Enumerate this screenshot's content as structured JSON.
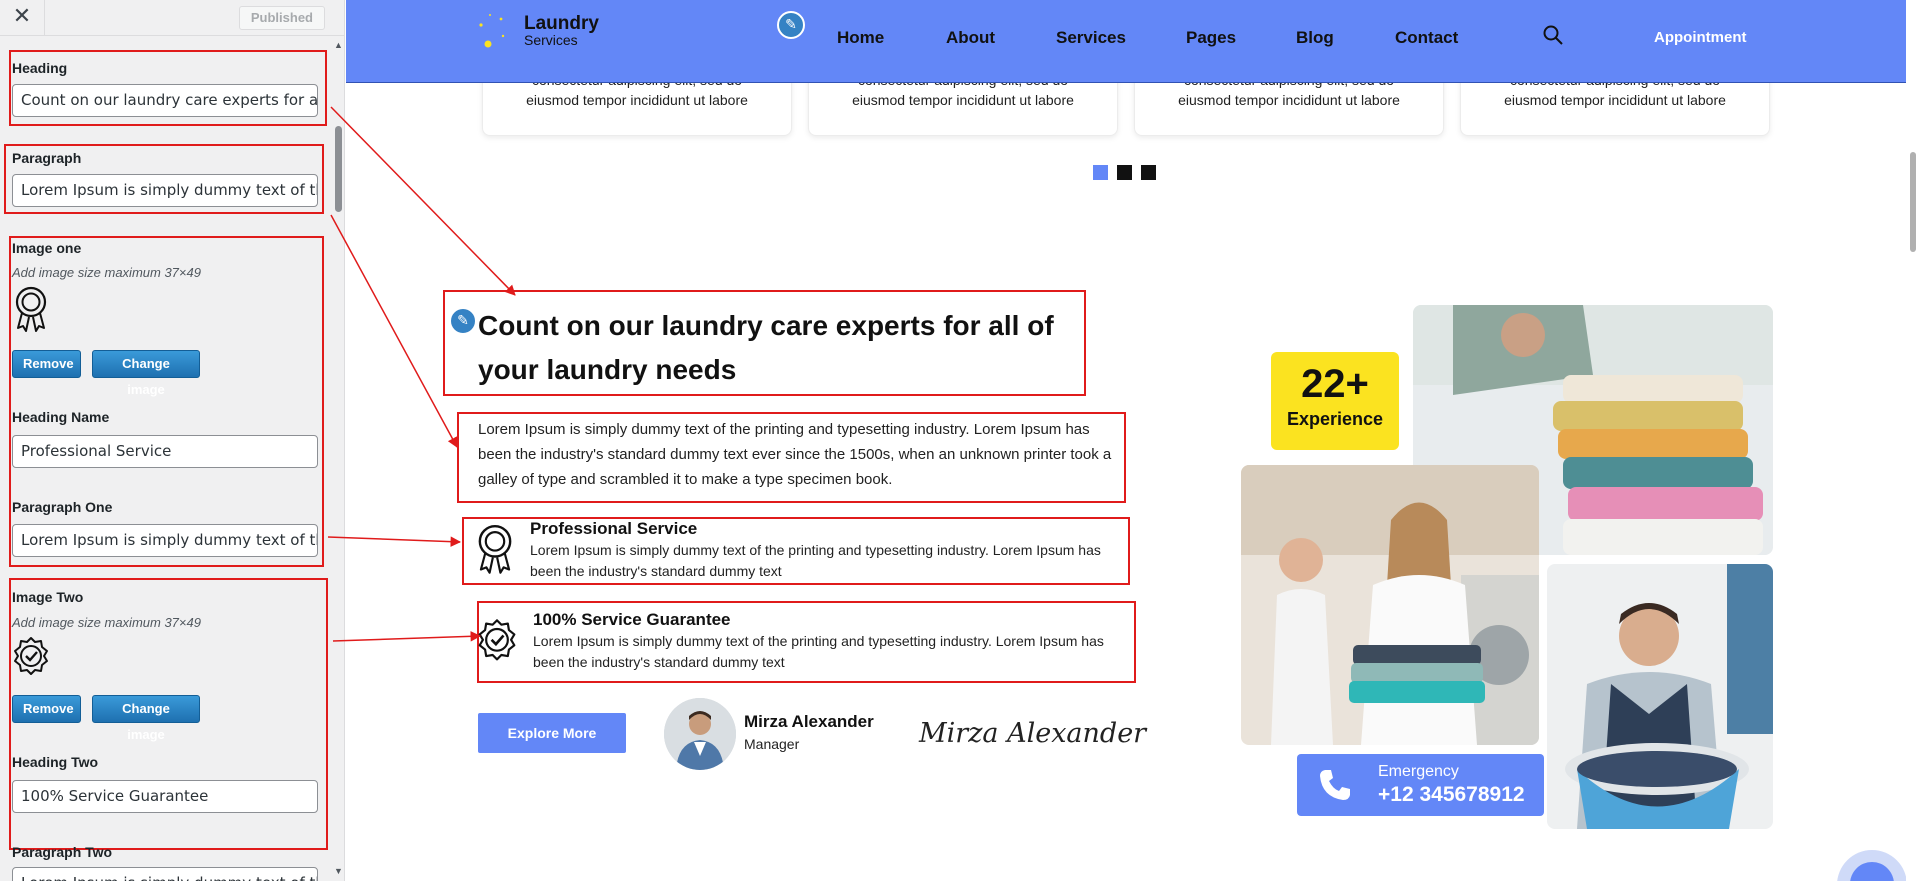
{
  "sidebar": {
    "close_glyph": "✕",
    "published_label": "Published",
    "heading": {
      "label": "Heading",
      "value": "Count on our laundry care experts for all"
    },
    "paragraph": {
      "label": "Paragraph",
      "value": "Lorem Ipsum is simply dummy text of th"
    },
    "image_one": {
      "label": "Image one",
      "hint": "Add image size maximum 37×49",
      "icon": "award-ribbon-icon",
      "remove_label": "Remove",
      "change_label": "Change image"
    },
    "heading_name": {
      "label": "Heading Name",
      "value": "Professional Service"
    },
    "paragraph_one": {
      "label": "Paragraph One",
      "value": "Lorem Ipsum is simply dummy text of th"
    },
    "image_two": {
      "label": "Image Two",
      "hint": "Add image size maximum 37×49",
      "icon": "check-badge-icon",
      "remove_label": "Remove",
      "change_label": "Change image"
    },
    "heading_two": {
      "label": "Heading Two",
      "value": "100% Service Guarantee"
    },
    "paragraph_two": {
      "label": "Paragraph Two",
      "value": "Lorem Ipsum is simply dummy text of th"
    }
  },
  "site": {
    "logo": {
      "title": "Laundry",
      "subtitle": "Services"
    },
    "nav": [
      "Home",
      "About",
      "Services",
      "Pages",
      "Blog",
      "Contact"
    ],
    "appointment_label": "Appointment",
    "service_cards": [
      {
        "cut_line": "consectetur adipiscing elit, sed do",
        "line": "eiusmod tempor incididunt ut labore"
      },
      {
        "cut_line": "consectetur adipiscing elit, sed do",
        "line": "eiusmod tempor incididunt ut labore"
      },
      {
        "cut_line": "consectetur adipiscing elit, sed do",
        "line": "eiusmod tempor incididunt ut labore"
      },
      {
        "cut_line": "consectetur adipiscing elit, sed do",
        "line": "eiusmod tempor incididunt ut labore"
      }
    ],
    "slider_dots": {
      "count": 3,
      "active_index": 0
    },
    "about": {
      "heading": "Count on our laundry care experts for all of your laundry needs",
      "paragraph": "Lorem Ipsum is simply dummy text of the printing and typesetting industry. Lorem Ipsum has been the industry's standard dummy text ever since the 1500s, when an unknown printer took a galley of type and scrambled it to make a type specimen book.",
      "features": [
        {
          "icon": "award-ribbon-icon",
          "title": "Professional Service",
          "text": "Lorem Ipsum is simply dummy text of the printing and typesetting industry. Lorem Ipsum has been the industry's standard dummy text"
        },
        {
          "icon": "check-badge-icon",
          "title": "100% Service Guarantee",
          "text": "Lorem Ipsum is simply dummy text of the printing and typesetting industry. Lorem Ipsum has been the industry's standard dummy text"
        }
      ],
      "explore_label": "Explore More",
      "manager": {
        "name": "Mirza Alexander",
        "role": "Manager",
        "signature": "Mirza Alexander"
      },
      "experience": {
        "number": "22+",
        "label": "Experience"
      },
      "emergency": {
        "label": "Emergency",
        "phone": "+12 345678912"
      }
    }
  },
  "colors": {
    "brand_blue": "#6387f7",
    "accent_yellow": "#fbe320",
    "highlight_red": "#e01b1b",
    "wp_blue": "#2271b1"
  }
}
